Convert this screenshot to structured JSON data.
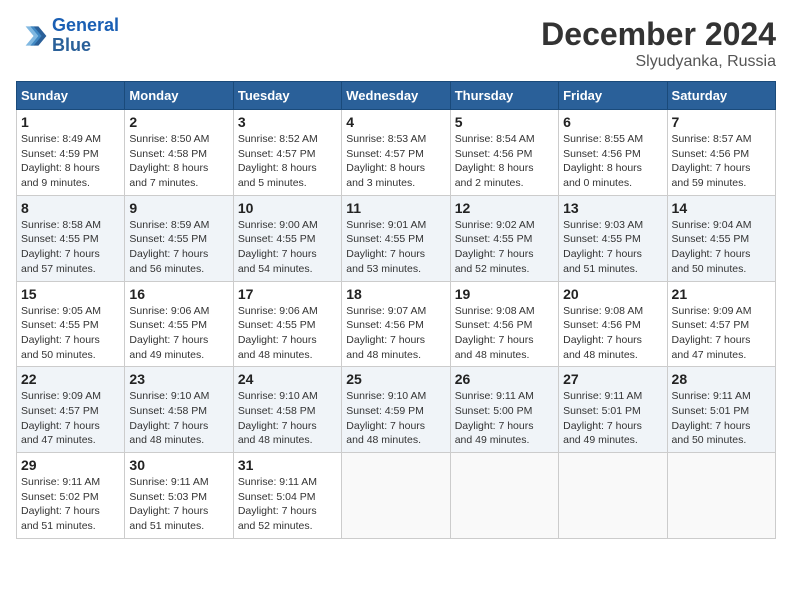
{
  "logo": {
    "line1": "General",
    "line2": "Blue"
  },
  "title": "December 2024",
  "subtitle": "Slyudyanka, Russia",
  "weekdays": [
    "Sunday",
    "Monday",
    "Tuesday",
    "Wednesday",
    "Thursday",
    "Friday",
    "Saturday"
  ],
  "weeks": [
    [
      {
        "day": 1,
        "info": "Sunrise: 8:49 AM\nSunset: 4:59 PM\nDaylight: 8 hours\nand 9 minutes."
      },
      {
        "day": 2,
        "info": "Sunrise: 8:50 AM\nSunset: 4:58 PM\nDaylight: 8 hours\nand 7 minutes."
      },
      {
        "day": 3,
        "info": "Sunrise: 8:52 AM\nSunset: 4:57 PM\nDaylight: 8 hours\nand 5 minutes."
      },
      {
        "day": 4,
        "info": "Sunrise: 8:53 AM\nSunset: 4:57 PM\nDaylight: 8 hours\nand 3 minutes."
      },
      {
        "day": 5,
        "info": "Sunrise: 8:54 AM\nSunset: 4:56 PM\nDaylight: 8 hours\nand 2 minutes."
      },
      {
        "day": 6,
        "info": "Sunrise: 8:55 AM\nSunset: 4:56 PM\nDaylight: 8 hours\nand 0 minutes."
      },
      {
        "day": 7,
        "info": "Sunrise: 8:57 AM\nSunset: 4:56 PM\nDaylight: 7 hours\nand 59 minutes."
      }
    ],
    [
      {
        "day": 8,
        "info": "Sunrise: 8:58 AM\nSunset: 4:55 PM\nDaylight: 7 hours\nand 57 minutes."
      },
      {
        "day": 9,
        "info": "Sunrise: 8:59 AM\nSunset: 4:55 PM\nDaylight: 7 hours\nand 56 minutes."
      },
      {
        "day": 10,
        "info": "Sunrise: 9:00 AM\nSunset: 4:55 PM\nDaylight: 7 hours\nand 54 minutes."
      },
      {
        "day": 11,
        "info": "Sunrise: 9:01 AM\nSunset: 4:55 PM\nDaylight: 7 hours\nand 53 minutes."
      },
      {
        "day": 12,
        "info": "Sunrise: 9:02 AM\nSunset: 4:55 PM\nDaylight: 7 hours\nand 52 minutes."
      },
      {
        "day": 13,
        "info": "Sunrise: 9:03 AM\nSunset: 4:55 PM\nDaylight: 7 hours\nand 51 minutes."
      },
      {
        "day": 14,
        "info": "Sunrise: 9:04 AM\nSunset: 4:55 PM\nDaylight: 7 hours\nand 50 minutes."
      }
    ],
    [
      {
        "day": 15,
        "info": "Sunrise: 9:05 AM\nSunset: 4:55 PM\nDaylight: 7 hours\nand 50 minutes."
      },
      {
        "day": 16,
        "info": "Sunrise: 9:06 AM\nSunset: 4:55 PM\nDaylight: 7 hours\nand 49 minutes."
      },
      {
        "day": 17,
        "info": "Sunrise: 9:06 AM\nSunset: 4:55 PM\nDaylight: 7 hours\nand 48 minutes."
      },
      {
        "day": 18,
        "info": "Sunrise: 9:07 AM\nSunset: 4:56 PM\nDaylight: 7 hours\nand 48 minutes."
      },
      {
        "day": 19,
        "info": "Sunrise: 9:08 AM\nSunset: 4:56 PM\nDaylight: 7 hours\nand 48 minutes."
      },
      {
        "day": 20,
        "info": "Sunrise: 9:08 AM\nSunset: 4:56 PM\nDaylight: 7 hours\nand 48 minutes."
      },
      {
        "day": 21,
        "info": "Sunrise: 9:09 AM\nSunset: 4:57 PM\nDaylight: 7 hours\nand 47 minutes."
      }
    ],
    [
      {
        "day": 22,
        "info": "Sunrise: 9:09 AM\nSunset: 4:57 PM\nDaylight: 7 hours\nand 47 minutes."
      },
      {
        "day": 23,
        "info": "Sunrise: 9:10 AM\nSunset: 4:58 PM\nDaylight: 7 hours\nand 48 minutes."
      },
      {
        "day": 24,
        "info": "Sunrise: 9:10 AM\nSunset: 4:58 PM\nDaylight: 7 hours\nand 48 minutes."
      },
      {
        "day": 25,
        "info": "Sunrise: 9:10 AM\nSunset: 4:59 PM\nDaylight: 7 hours\nand 48 minutes."
      },
      {
        "day": 26,
        "info": "Sunrise: 9:11 AM\nSunset: 5:00 PM\nDaylight: 7 hours\nand 49 minutes."
      },
      {
        "day": 27,
        "info": "Sunrise: 9:11 AM\nSunset: 5:01 PM\nDaylight: 7 hours\nand 49 minutes."
      },
      {
        "day": 28,
        "info": "Sunrise: 9:11 AM\nSunset: 5:01 PM\nDaylight: 7 hours\nand 50 minutes."
      }
    ],
    [
      {
        "day": 29,
        "info": "Sunrise: 9:11 AM\nSunset: 5:02 PM\nDaylight: 7 hours\nand 51 minutes."
      },
      {
        "day": 30,
        "info": "Sunrise: 9:11 AM\nSunset: 5:03 PM\nDaylight: 7 hours\nand 51 minutes."
      },
      {
        "day": 31,
        "info": "Sunrise: 9:11 AM\nSunset: 5:04 PM\nDaylight: 7 hours\nand 52 minutes."
      },
      null,
      null,
      null,
      null
    ]
  ]
}
